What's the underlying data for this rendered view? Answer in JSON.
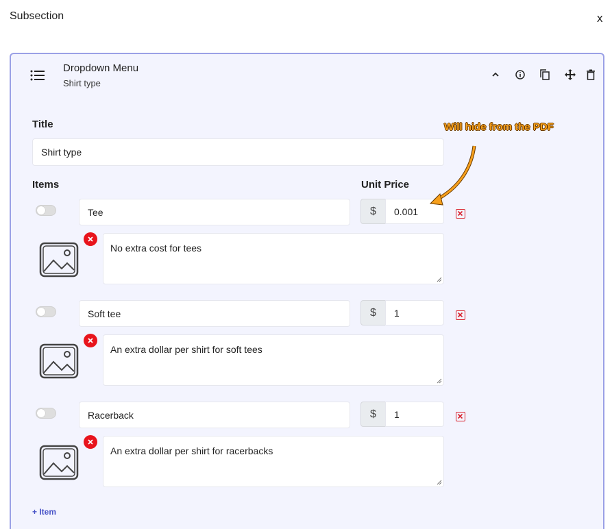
{
  "modal": {
    "title": "Subsection",
    "close_label": "x"
  },
  "card": {
    "title": "Dropdown Menu",
    "subtitle": "Shirt type",
    "toolbar_icons": [
      "chevron-up-icon",
      "info-icon",
      "copy-icon",
      "move-icon",
      "trash-icon"
    ]
  },
  "form": {
    "title_label": "Title",
    "title_value": "Shirt type",
    "items_label": "Items",
    "unit_price_label": "Unit Price",
    "currency_symbol": "$",
    "items": [
      {
        "name": "Tee",
        "price": "0.001",
        "description": "No extra cost for tees",
        "enabled": false
      },
      {
        "name": "Soft tee",
        "price": "1",
        "description": "An extra dollar per shirt for soft tees",
        "enabled": false
      },
      {
        "name": "Racerback",
        "price": "1",
        "description": "An extra dollar per shirt for racerbacks",
        "enabled": false
      }
    ],
    "add_item_label": "+ Item"
  },
  "annotation": {
    "text": "Will hide from the PDF",
    "color": "#f7a01c"
  },
  "colors": {
    "card_border": "#9aa0e6",
    "card_bg": "#f3f4fe",
    "delete_red": "#e8141c",
    "link_blue": "#4a55c8"
  }
}
